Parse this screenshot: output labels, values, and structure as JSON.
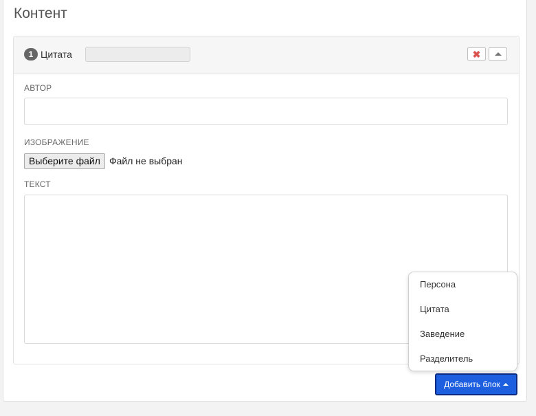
{
  "panel": {
    "title": "Контент"
  },
  "block": {
    "number": "1",
    "type": "Цитата",
    "header_input_value": "",
    "remove_icon": "close-icon",
    "collapse_icon": "triangle-up-icon"
  },
  "fields": {
    "author": {
      "label": "АВТОР",
      "value": ""
    },
    "image": {
      "label": "ИЗОБРАЖЕНИЕ",
      "button_label": "Выберите файл",
      "status": "Файл не выбран"
    },
    "text": {
      "label": "ТЕКСТ",
      "value": ""
    }
  },
  "add_block": {
    "label": "Добавить блок",
    "options": [
      "Персона",
      "Цитата",
      "Заведение",
      "Разделитель"
    ]
  },
  "colors": {
    "accent": "#1e5fe0",
    "remove": "#d9534f"
  }
}
